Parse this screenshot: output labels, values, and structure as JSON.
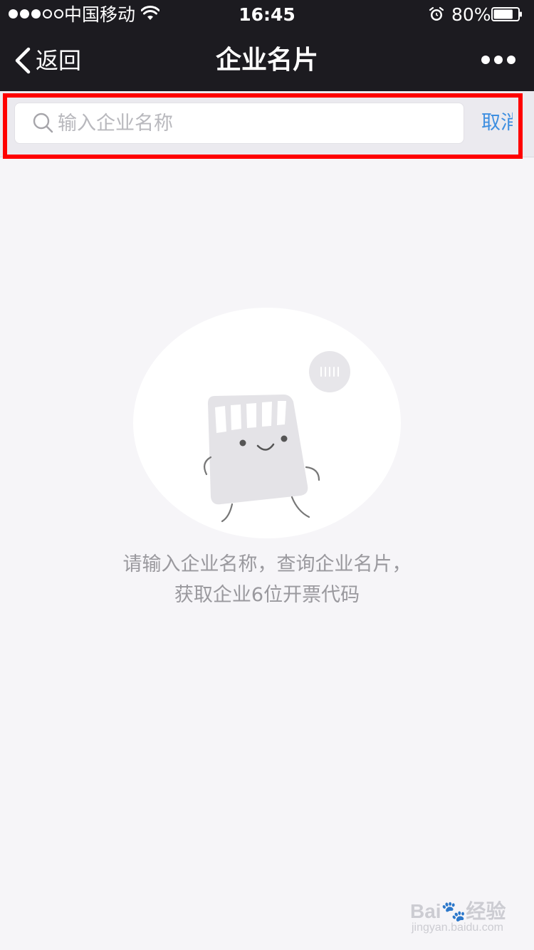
{
  "status_bar": {
    "carrier": "中国移动",
    "time": "16:45",
    "battery": "80%",
    "battery_level": 0.8
  },
  "nav": {
    "back_label": "返回",
    "title": "企业名片"
  },
  "search": {
    "placeholder": "输入企业名称",
    "value": "",
    "cancel_label": "取消"
  },
  "empty_state": {
    "line1": "请输入企业名称，查询企业名片，",
    "line2": "获取企业6位开票代码"
  },
  "watermark": {
    "brand": "Bai🐾经验",
    "url": "jingyan.baidu.com"
  },
  "colors": {
    "nav_bg": "#1c1b20",
    "page_bg": "#f6f5f8",
    "accent": "#3d8ee0",
    "highlight": "#ff0000"
  }
}
